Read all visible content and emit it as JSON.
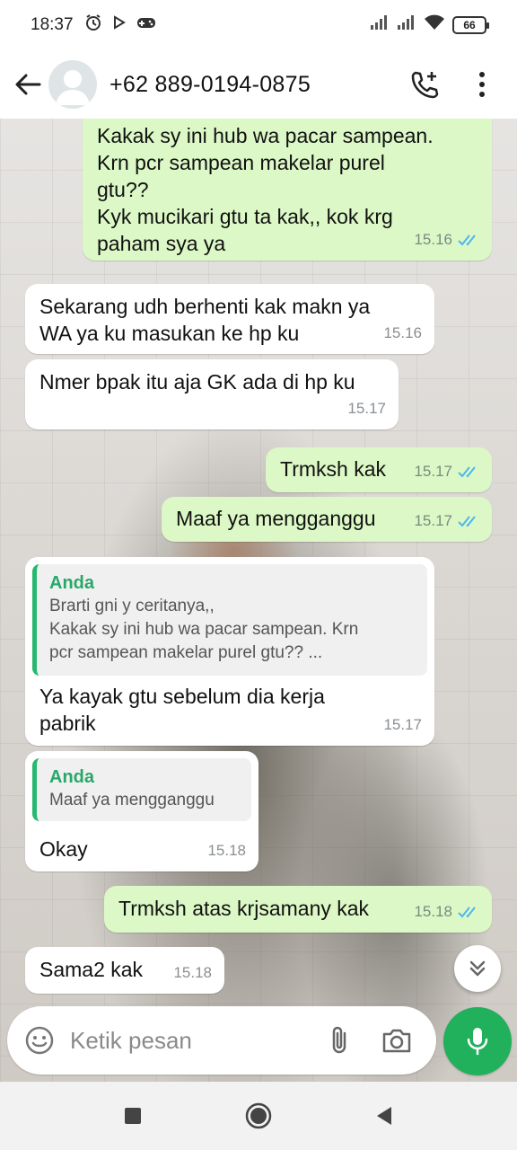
{
  "status_bar": {
    "time": "18:37",
    "battery": "66"
  },
  "header": {
    "contact": "+62 889-0194-0875"
  },
  "messages": [
    {
      "direction": "out",
      "text": "Kakak sy ini hub wa pacar sampean.\nKrn pcr sampean makelar purel\ngtu??\nKyk mucikari gtu ta kak,, kok krg\npaham sya ya",
      "time": "15.16",
      "read": true
    },
    {
      "direction": "in",
      "text": "Sekarang udh berhenti kak makn ya\nWA ya ku masukan ke hp ku",
      "time": "15.16"
    },
    {
      "direction": "in",
      "text": "Nmer bpak itu aja GK ada di hp ku",
      "time": "15.17"
    },
    {
      "direction": "out",
      "text": "Trmksh kak",
      "time": "15.17",
      "read": true
    },
    {
      "direction": "out",
      "text": "Maaf ya mengganggu",
      "time": "15.17",
      "read": true
    },
    {
      "direction": "in",
      "quote": {
        "author": "Anda",
        "text": "Brarti gni y ceritanya,,\nKakak sy ini hub wa pacar sampean. Krn\npcr sampean makelar purel gtu?? ..."
      },
      "text": "Ya kayak gtu sebelum dia kerja\npabrik",
      "time": "15.17"
    },
    {
      "direction": "in",
      "quote": {
        "author": "Anda",
        "text": "Maaf ya mengganggu"
      },
      "text": "Okay",
      "time": "15.18"
    },
    {
      "direction": "out",
      "text": "Trmksh atas krjsamany kak",
      "time": "15.18",
      "read": true
    },
    {
      "direction": "in",
      "text": "Sama2 kak",
      "time": "15.18"
    }
  ],
  "composer": {
    "placeholder": "Ketik pesan"
  },
  "colors": {
    "outgoing_bubble": "#dcf8c6",
    "incoming_bubble": "#ffffff",
    "accent_green": "#21b05c",
    "read_ticks": "#4fb6ec"
  },
  "icons": [
    "back-arrow-icon",
    "avatar-icon",
    "add-call-icon",
    "more-vert-icon",
    "emoji-icon",
    "attach-icon",
    "camera-icon",
    "mic-icon",
    "scroll-down-icon",
    "recents-icon",
    "home-icon",
    "back-icon"
  ]
}
